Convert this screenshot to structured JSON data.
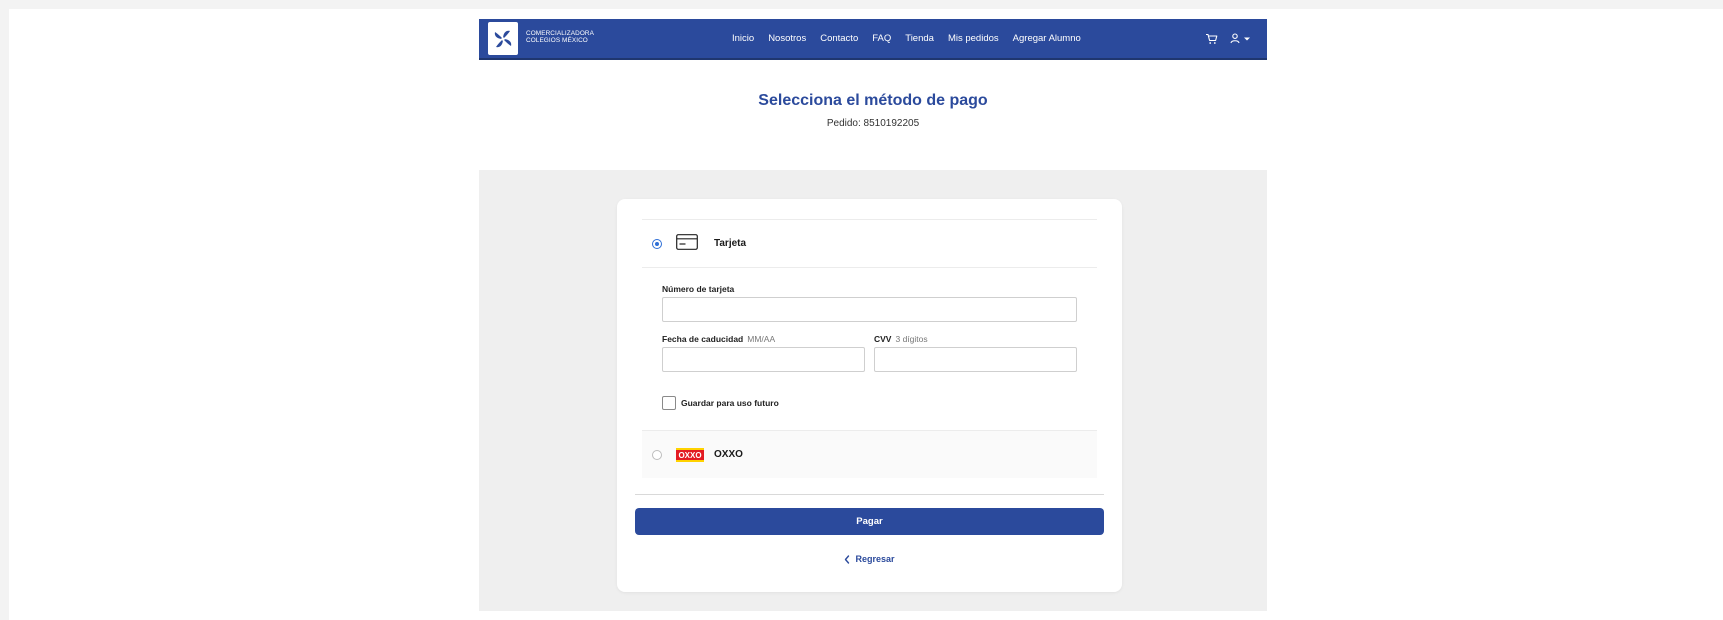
{
  "brand": {
    "line1": "COMERCIALIZADORA",
    "line2": "COLEGIOS MÉXICO"
  },
  "nav": {
    "links": [
      "Inicio",
      "Nosotros",
      "Contacto",
      "FAQ",
      "Tienda",
      "Mis pedidos",
      "Agregar Alumno"
    ],
    "icons": [
      "cart-icon",
      "user-icon",
      "caret-down-icon"
    ]
  },
  "header": {
    "title": "Selecciona el método de pago",
    "order_text": "Pedido: 8510192205"
  },
  "payment": {
    "methods": [
      {
        "label": "Tarjeta",
        "icon": "credit-card-icon",
        "selected": true
      },
      {
        "label": "OXXO",
        "icon": "oxxo-logo",
        "selected": false
      }
    ],
    "card_number": {
      "label": "Número de tarjeta",
      "value": "",
      "placeholder": ""
    },
    "expiry": {
      "label": "Fecha de caducidad",
      "hint": "MM/AA",
      "value": ""
    },
    "cvv": {
      "label": "CVV",
      "hint": "3 dígitos",
      "value": ""
    },
    "save_checkbox": {
      "label": "Guardar para uso futuro",
      "checked": false
    }
  },
  "actions": {
    "pay_label": "Pagar",
    "back_label": "Regresar"
  },
  "colors": {
    "primary": "#2b4a9c",
    "radio_selected": "#2f6fd6",
    "oxxo_red": "#e31b23",
    "oxxo_yellow": "#ffd200",
    "panel_bg": "#efefef"
  }
}
